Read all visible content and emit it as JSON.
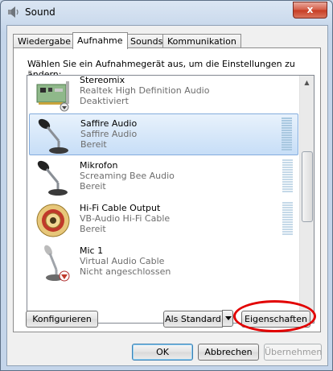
{
  "window": {
    "title": "Sound",
    "close_label": "x"
  },
  "tabs": [
    {
      "label": "Wiedergabe",
      "active": false
    },
    {
      "label": "Aufnahme",
      "active": true
    },
    {
      "label": "Sounds",
      "active": false
    },
    {
      "label": "Kommunikation",
      "active": false
    }
  ],
  "panel": {
    "instruction": "Wählen Sie ein Aufnahmegerät aus, um die Einstellungen zu ändern:"
  },
  "devices": [
    {
      "name": "Stereomix",
      "description": "Realtek High Definition Audio",
      "status": "Deaktiviert",
      "icon": "sound-card-icon",
      "badge": "disabled-arrow",
      "selected": false
    },
    {
      "name": "Saffire Audio",
      "description": "Saffire Audio",
      "status": "Bereit",
      "icon": "microphone-icon",
      "selected": true
    },
    {
      "name": "Mikrofon",
      "description": "Screaming Bee Audio",
      "status": "Bereit",
      "icon": "microphone-icon",
      "selected": false
    },
    {
      "name": "Hi-Fi Cable Output",
      "description": "VB-Audio Hi-Fi Cable",
      "status": "Bereit",
      "icon": "rca-jack-icon",
      "selected": false
    },
    {
      "name": "Mic 1",
      "description": "Virtual Audio Cable",
      "status": "Nicht angeschlossen",
      "icon": "microphone-icon",
      "badge": "disconnected-arrow",
      "selected": false
    }
  ],
  "buttons": {
    "configure": "Konfigurieren",
    "set_default": "Als Standard",
    "properties": "Eigenschaften",
    "ok": "OK",
    "cancel": "Abbrechen",
    "apply": "Übernehmen"
  },
  "colors": {
    "selection": "#cde3f8",
    "highlight_circle": "#e20000",
    "status_text": "#6d6d6d"
  }
}
